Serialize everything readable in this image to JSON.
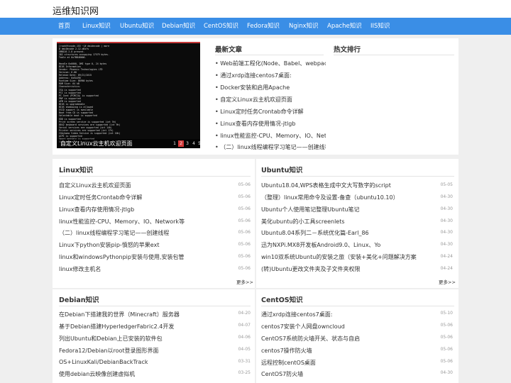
{
  "site_title": "运维知识网",
  "nav": [
    "首页",
    "Linux知识",
    "Ubuntu知识",
    "Debian知识",
    "CentOS知识",
    "Fedora知识",
    "Nginx知识",
    "Apache知识",
    "IIS知识"
  ],
  "slider": {
    "caption": "自定义Linux云主机欢迎页面",
    "pages": [
      "1",
      "2",
      "3",
      "4",
      "5"
    ],
    "active_page": 2,
    "terminal_lines": [
      "[root@fcnode-153 ~]# dmidecode | more",
      "# dmidecode 2.12-dmifs",
      "SMBIOS 2.8 present.",
      "382 structures occupying 17579 bytes.",
      "Table at 0x7BB4B000.",
      "",
      "Handle 0x0000, DMI type 0, 24 bytes",
      "BIOS Information",
      "    Vendor: Phoenix Technologies LTD",
      "    Version: 6.00",
      "    Release Date: 09/21/2015",
      "    Address: 0xEA490",
      "    Runtime Size: 88960 bytes",
      "    ROM Size: 64 kB",
      "    Characteristics:",
      "        ISA is supported",
      "        PCI is supported",
      "        PC Card (PCMCIA) is supported",
      "        PNP is supported",
      "        APM is supported",
      "        BIOS is upgradeable",
      "        BIOS shadowing is allowed",
      "        ESCD support is available",
      "        Boot from CD is supported",
      "        Selectable boot is supported",
      "        EDD is supported",
      "        Print screen service is supported (int 5h)",
      "        8042 keyboard services are supported (int 9h)",
      "        Serial services are supported (int 14h)",
      "        Printer services are supported (int 17h)",
      "        CGA/mono Video Service is supported (int 10h)",
      "        ACPI is supported",
      "        Smart battery is supported",
      "        BIOS boot specification is supported",
      "--More--"
    ]
  },
  "latest": {
    "title": "最新文章",
    "items": [
      "• Web前端工程化(Node、Babel、webpack、",
      "• 通过xrdp连接centos7桌面:",
      "• Docker安装和启用Apache",
      "• 自定义Linux云主机欢迎页面",
      "• Linux定时任务Crontab命令详解",
      "• Linux查看内存使用情况-jtlgb",
      "• linux性能监控-CPU、Memory、IO、Netw",
      "• （二）linux线程编程学习笔记——创建线程"
    ]
  },
  "hot": {
    "title": "热文排行"
  },
  "more_label": "更多>>",
  "sections": [
    {
      "title": "Linux知识",
      "items": [
        {
          "text": "自定义Linux云主机欢迎页面",
          "date": "05-06"
        },
        {
          "text": "Linux定时任务Crontab命令详解",
          "date": "05-06"
        },
        {
          "text": "Linux查看内存使用情况-jtlgb",
          "date": "05-06"
        },
        {
          "text": "linux性能监控-CPU、Memory、IO、Network等",
          "date": "05-06"
        },
        {
          "text": "（二）linux线程编程学习笔记——创建线程",
          "date": "05-06"
        },
        {
          "text": "Linux下python安装pip-憤怒的苹果ext",
          "date": "05-06"
        },
        {
          "text": "linux和windowsPythonpip安装与使用,安装包管",
          "date": "05-06"
        },
        {
          "text": "linux修改主机名",
          "date": "05-06"
        }
      ]
    },
    {
      "title": "Ubuntu知识",
      "items": [
        {
          "text": "Ubuntu18.04,WPS表格生成中文大写数字的script",
          "date": "05-05"
        },
        {
          "text": "（整理）linux常用命令及设置-备查（ubuntu10.10）",
          "date": "04-30"
        },
        {
          "text": "Ubuntu个人使用笔记整理Ubuntu笔记",
          "date": "04-30"
        },
        {
          "text": "美化ubuntu的小工具screenlets",
          "date": "04-30"
        },
        {
          "text": "Ubuntu8.04系列二－系统优化篇-Earl_86",
          "date": "04-30"
        },
        {
          "text": "迅为NXPi.MX8开发板Android9.0、Linux、Yo",
          "date": "04-30"
        },
        {
          "text": "win10双系统Ubuntu的安装之旅（安装+美化+问题解决方案",
          "date": "04-24"
        },
        {
          "text": "(转)Ubuntu更改文件夹及子文件夹权限",
          "date": "04-24"
        }
      ]
    },
    {
      "title": "Debian知识",
      "items": [
        {
          "text": "在Debian下搭建我的世界（Minecraft）服务器",
          "date": "04-20"
        },
        {
          "text": "基于Debian搭建HyperledgerFabric2.4开发",
          "date": "04-07"
        },
        {
          "text": "列出Ubuntu和Debian上已安装的软件包",
          "date": "04-06"
        },
        {
          "text": "Fedora12/Debian以root登录图形界面",
          "date": "04-05"
        },
        {
          "text": "OS+LinuxKali/DebianBackTrack",
          "date": "03-31"
        },
        {
          "text": "使用debian云映像创建虚拟机",
          "date": "03-25"
        }
      ]
    },
    {
      "title": "CentOS知识",
      "items": [
        {
          "text": "通过xrdp连接centos7桌面:",
          "date": "05-10"
        },
        {
          "text": "centos7安装个人网盘owncloud",
          "date": "05-06"
        },
        {
          "text": "CentOS7系统防火墙开关、状态与自启",
          "date": "05-06"
        },
        {
          "text": "centos7操作防火墙",
          "date": "05-06"
        },
        {
          "text": "远程控制centOS桌面",
          "date": "05-06"
        },
        {
          "text": "CentOS7防火墙",
          "date": "04-30"
        }
      ]
    }
  ]
}
